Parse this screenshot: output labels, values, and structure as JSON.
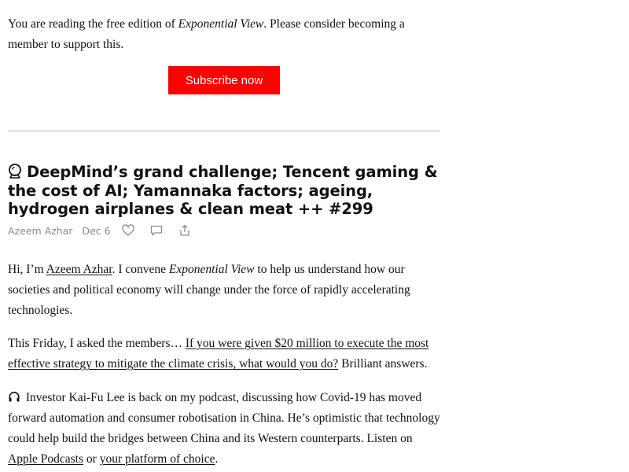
{
  "banner": {
    "text_before": "You are reading the free edition of ",
    "publication": "Exponential View",
    "text_after": ". Please consider becoming a member to support this.",
    "subscribe_label": "Subscribe now"
  },
  "post": {
    "title_emoji_icon": "crystal-ball-icon",
    "title": "DeepMind’s grand challenge; Tencent gaming & the cost of AI; Yamannaka factors; ageing, hydrogen airplanes & clean meat ++ #299",
    "author": "Azeem Azhar",
    "date": "Dec 6",
    "action_icons": [
      "heart-icon",
      "comment-icon",
      "share-icon"
    ]
  },
  "body": {
    "p1": {
      "before_link": "Hi, I’m ",
      "author_link": "Azeem Azhar",
      "mid": ". I convene ",
      "publication": "Exponential View",
      "after": " to help us understand how our societies and political economy will change under the force of rapidly accelerating technologies."
    },
    "p2": {
      "before_link": "This Friday, I asked the members… ",
      "link": "If you were given $20 million to execute the most effective strategy to mitigate the climate crisis, what would you do?",
      "after": " Brilliant answers."
    },
    "p3": {
      "icon": "headphones-icon",
      "text": " Investor Kai-Fu Lee is back on my podcast, discussing how Covid-19 has moved forward automation and consumer robotisation in China. He’s optimistic that technology could help build the bridges between China and its Western counterparts. Listen on ",
      "link1": "Apple Podcasts",
      "between": " or ",
      "link2": "your platform of choice",
      "end": "."
    }
  },
  "colors": {
    "subscribe_bg": "#ff0000",
    "subscribe_text": "#ffffff",
    "meta_text": "#8a8a8a",
    "divider": "#b0b0b0",
    "body_text": "#111111"
  }
}
